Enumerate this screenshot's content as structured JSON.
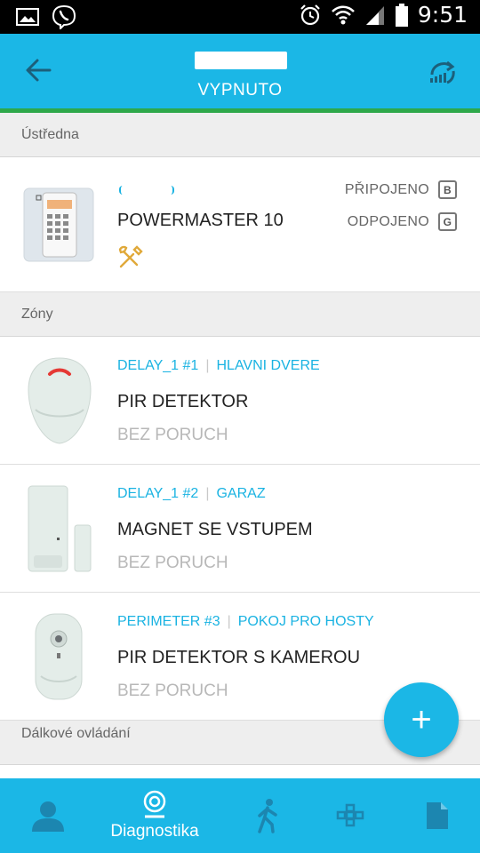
{
  "statusbar": {
    "time": "9:51"
  },
  "appbar": {
    "subtitle": "VYPNUTO"
  },
  "sections": {
    "panel": "Ústředna",
    "zones": "Zóny",
    "remotes": "Dálkové ovládání"
  },
  "panel": {
    "name": "POWERMASTER 10",
    "connections": [
      {
        "label": "PŘIPOJENO",
        "badge": "B"
      },
      {
        "label": "ODPOJENO",
        "badge": "G"
      }
    ]
  },
  "zones": [
    {
      "tag": "DELAY_1 #1",
      "location": "HLAVNI DVERE",
      "name": "PIR DETEKTOR",
      "status": "BEZ PORUCH"
    },
    {
      "tag": "DELAY_1 #2",
      "location": "GARAZ",
      "name": "MAGNET SE VSTUPEM",
      "status": "BEZ PORUCH"
    },
    {
      "tag": "PERIMETER #3",
      "location": "POKOJ PRO HOSTY",
      "name": "PIR DETEKTOR S KAMEROU",
      "status": "BEZ PORUCH"
    }
  ],
  "fab": {
    "label": "+"
  },
  "bottomnav": {
    "active_label": "Diagnostika",
    "items": [
      "user-icon",
      "diagnostics-icon",
      "walking-person-icon",
      "devices-grid-icon",
      "document-icon"
    ]
  },
  "colors": {
    "primary": "#1bb7e6",
    "accent_line": "#2ea84a",
    "tag": "#1ab3e2"
  }
}
